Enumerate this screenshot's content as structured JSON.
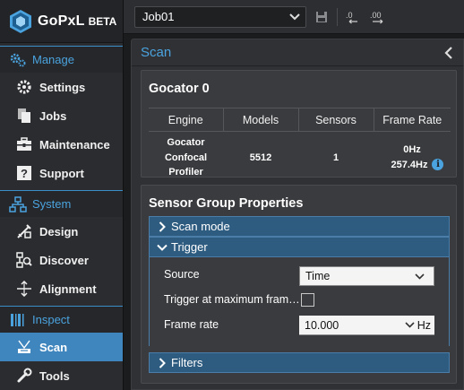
{
  "brand": {
    "name": "GoPxL",
    "badge": "BETA"
  },
  "sidebar": {
    "sections": [
      {
        "label": "Manage",
        "icon": "gears-icon",
        "items": [
          {
            "label": "Settings",
            "icon": "gear-icon"
          },
          {
            "label": "Jobs",
            "icon": "documents-icon"
          },
          {
            "label": "Maintenance",
            "icon": "toolbox-icon"
          },
          {
            "label": "Support",
            "icon": "help-icon"
          }
        ]
      },
      {
        "label": "System",
        "icon": "network-icon",
        "items": [
          {
            "label": "Design",
            "icon": "design-icon"
          },
          {
            "label": "Discover",
            "icon": "discover-icon"
          },
          {
            "label": "Alignment",
            "icon": "alignment-icon"
          }
        ]
      },
      {
        "label": "Inspect",
        "icon": "inspect-icon",
        "items": [
          {
            "label": "Scan",
            "icon": "scan-icon",
            "active": true
          },
          {
            "label": "Tools",
            "icon": "wrench-icon"
          }
        ]
      }
    ]
  },
  "topbar": {
    "job": "Job01"
  },
  "scan": {
    "title": "Scan",
    "device": {
      "title": "Gocator 0",
      "columns": [
        "Engine",
        "Models",
        "Sensors",
        "Frame Rate"
      ],
      "engine": [
        "Gocator",
        "Confocal",
        "Profiler"
      ],
      "models": "5512",
      "sensors": "1",
      "frame_rate_line1": "0Hz",
      "frame_rate_line2": "257.4Hz"
    },
    "group": {
      "title": "Sensor Group Properties",
      "sections": {
        "scan_mode": "Scan mode",
        "trigger": "Trigger",
        "filters": "Filters"
      },
      "trigger": {
        "source_label": "Source",
        "source_value": "Time",
        "max_frame_label": "Trigger at maximum fram…",
        "max_frame_checked": false,
        "frame_rate_label": "Frame rate",
        "frame_rate_value": "10.000",
        "frame_rate_unit": "Hz"
      }
    }
  },
  "colors": {
    "accent": "#4aa3df",
    "active_nav": "#3f86bf",
    "accordion": "#2e5c80"
  }
}
